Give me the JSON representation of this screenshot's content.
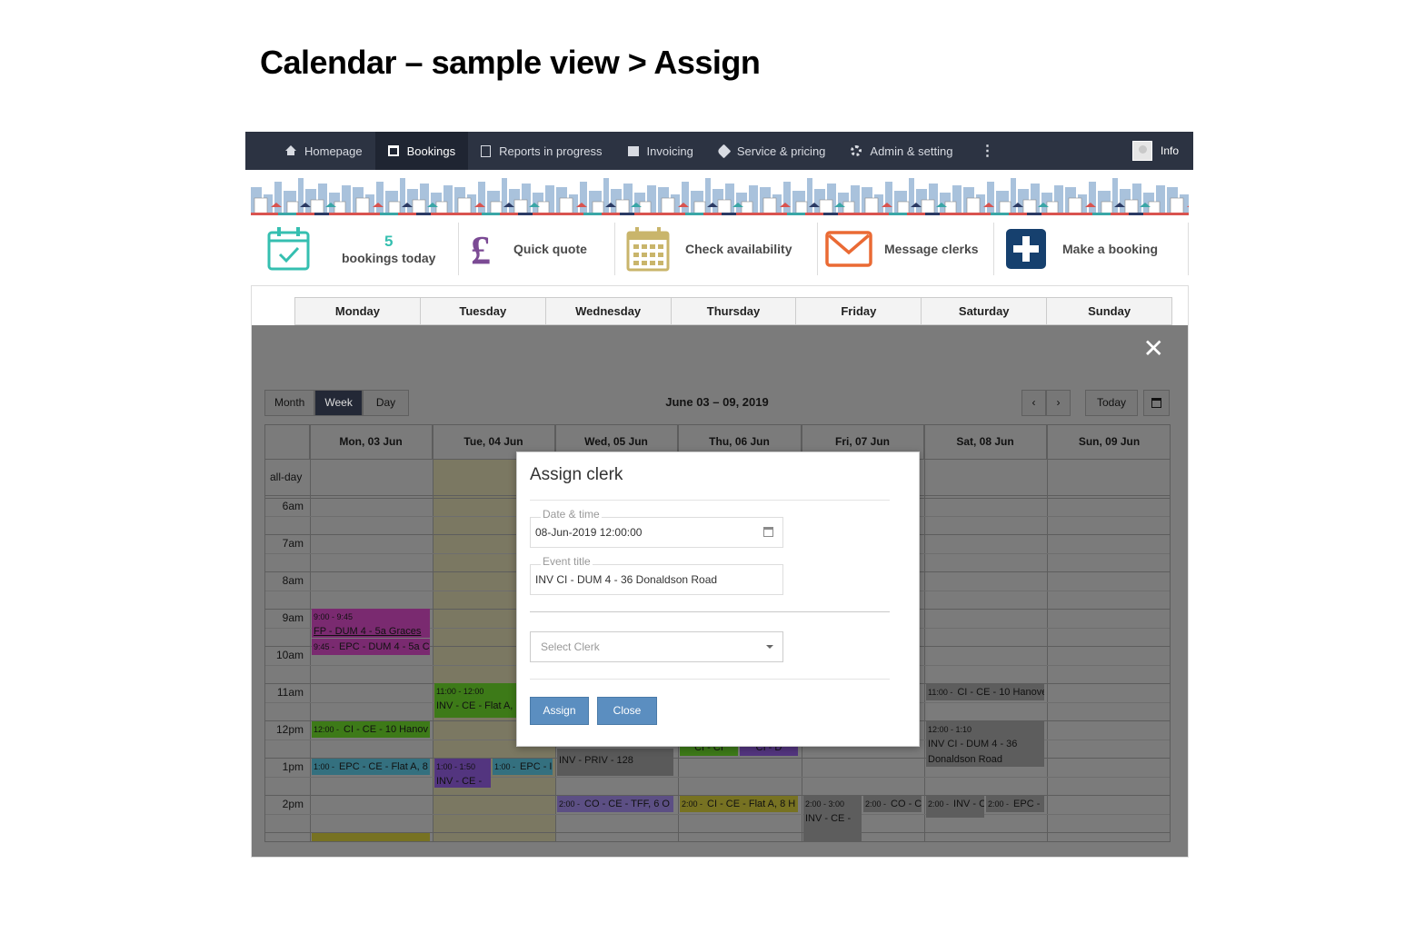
{
  "slide_title": "Calendar – sample view > Assign",
  "nav": {
    "items": [
      {
        "label": "Homepage"
      },
      {
        "label": "Bookings"
      },
      {
        "label": "Reports in progress"
      },
      {
        "label": "Invoicing"
      },
      {
        "label": "Service & pricing"
      },
      {
        "label": "Admin & setting"
      }
    ],
    "more": "⋮",
    "user_label": "Info"
  },
  "actions": {
    "bookings_count": "5",
    "bookings_label": "bookings today",
    "quick_quote": "Quick quote",
    "check_availability": "Check availability",
    "message_clerks": "Message clerks",
    "make_booking": "Make a booking"
  },
  "day_header": [
    "Monday",
    "Tuesday",
    "Wednesday",
    "Thursday",
    "Friday",
    "Saturday",
    "Sunday"
  ],
  "overlay": {
    "close": "✕"
  },
  "calendar": {
    "views": {
      "month": "Month",
      "week": "Week",
      "day": "Day"
    },
    "range": "June 03 – 09, 2019",
    "prev": "‹",
    "next": "›",
    "today": "Today",
    "columns": [
      "Mon, 03 Jun",
      "Tue, 04 Jun",
      "Wed, 05 Jun",
      "Thu, 06 Jun",
      "Fri, 07 Jun",
      "Sat, 08 Jun",
      "Sun, 09 Jun"
    ],
    "allday": "all-day",
    "hours": [
      "6am",
      "7am",
      "8am",
      "9am",
      "10am",
      "11am",
      "12pm",
      "1pm",
      "2pm"
    ],
    "events": {
      "e1_time": "9:00 - 9:45",
      "e1_title": "FP - DUM 4 - 5a Graces",
      "e2_time": "9:45 -",
      "e2_title": "EPC - DUM 4 - 5a C",
      "e3_time": "11:00 - 12:00",
      "e3_title": "INV - CE - Flat A,",
      "e4_time": "12:00 -",
      "e4_title": "CI - CE - 10 Hanov",
      "e5_time": "1:00 -",
      "e5_title": "EPC - CE - Flat A, 8",
      "e6_time": "1:00 - 1:50",
      "e6_title": "INV - CE -",
      "e7_time": "1:00 -",
      "e7_title": "EPC - I",
      "e8_title": "INV - PRIV - 128",
      "e9_time": "2:00 -",
      "e9_title": "CO - CE - TFF, 6 O",
      "e10_time": "2:00 -",
      "e10_title": "CI - CE - Flat A, 8 H",
      "e11_time": "2:00 - 3:00",
      "e11_title": "INV - CE -",
      "e12_time": "2:00 -",
      "e12_title": "CO - C",
      "e13_time": "11:00 -",
      "e13_title": "CI - CE - 10 Hanove",
      "e14_time": "12:00 - 1:10",
      "e14_title": "INV CI - DUM 4 - 36 Donaldson Road",
      "e15_time": "2:00 -",
      "e15_title": "INV - C",
      "e16_time": "2:00 -",
      "e16_title": "EPC -",
      "e17_title": "CI - CI",
      "e18_title": "CI - D"
    }
  },
  "modal": {
    "title": "Assign clerk",
    "date_label": "Date & time",
    "date_value": "08-Jun-2019 12:00:00",
    "event_label": "Event title",
    "event_value": "INV CI - DUM 4 - 36 Donaldson Road",
    "select_placeholder": "Select Clerk",
    "assign": "Assign",
    "close": "Close"
  }
}
